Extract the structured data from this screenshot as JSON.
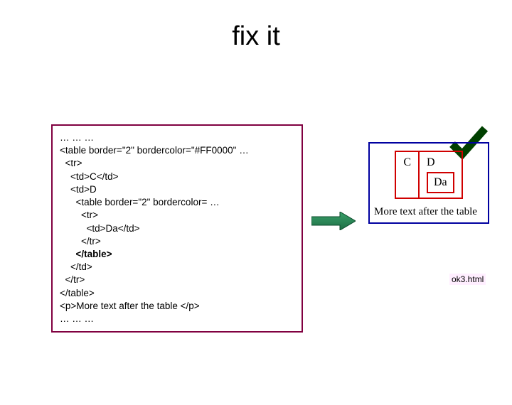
{
  "title": "fix it",
  "code": {
    "l0": "… … …",
    "l1": "<table border=\"2\" bordercolor=\"#FF0000\" …",
    "l2": "  <tr>",
    "l3": "    <td>C</td>",
    "l4": "    <td>D",
    "l5": "      <table border=\"2\" bordercolor= …",
    "l6": "        <tr>",
    "l7": "          <td>Da</td>",
    "l8": "        </tr>",
    "l9": "      </table>",
    "l10": "    </td>",
    "l11": "  </tr>",
    "l12": "</table>",
    "l13": "<p>More text after the table </p>",
    "l14": "… … …"
  },
  "result": {
    "cell_c": "C",
    "cell_d": "D",
    "cell_da": "Da",
    "caption": "More text after the table"
  },
  "filename": "ok3.html"
}
